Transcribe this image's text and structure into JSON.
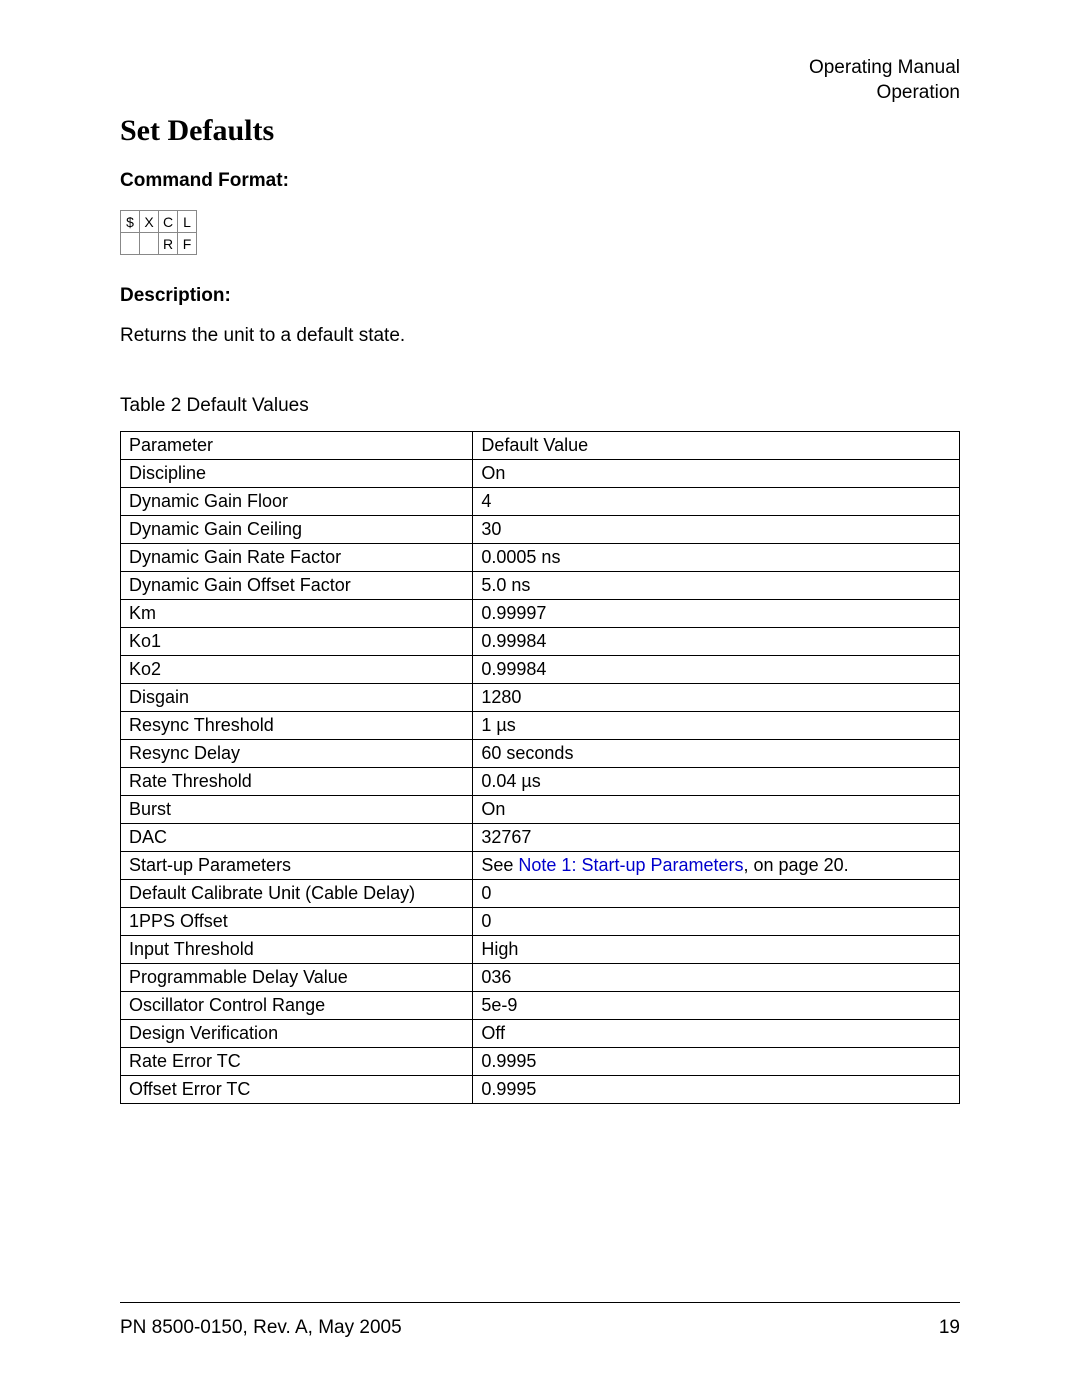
{
  "header": {
    "line1": "Operating Manual",
    "line2": "Operation"
  },
  "title": "Set Defaults",
  "labels": {
    "command_format": "Command Format:",
    "description": "Description:"
  },
  "command_grid": {
    "row1": [
      "$",
      "X",
      "C",
      "L"
    ],
    "row2": [
      "",
      "",
      "R",
      "F"
    ]
  },
  "description_text": "Returns the unit to a default state.",
  "table_caption": "Table 2  Default Values",
  "table": {
    "header": [
      "Parameter",
      "Default Value"
    ],
    "rows": [
      {
        "param": "Discipline",
        "value": "On"
      },
      {
        "param": "Dynamic Gain Floor",
        "value": "4"
      },
      {
        "param": "Dynamic Gain Ceiling",
        "value": "30"
      },
      {
        "param": "Dynamic Gain Rate Factor",
        "value": "0.0005 ns"
      },
      {
        "param": "Dynamic Gain Offset Factor",
        "value": "5.0 ns"
      },
      {
        "param": "Km",
        "value": "0.99997"
      },
      {
        "param": "Ko1",
        "value": "0.99984"
      },
      {
        "param": "Ko2",
        "value": "0.99984"
      },
      {
        "param": "Disgain",
        "value": "1280"
      },
      {
        "param": "Resync Threshold",
        "value": "1 µs"
      },
      {
        "param": "Resync Delay",
        "value": "60 seconds"
      },
      {
        "param": "Rate Threshold",
        "value": "0.04 µs"
      },
      {
        "param": "Burst",
        "value": "On"
      },
      {
        "param": "DAC",
        "value": "32767"
      },
      {
        "param": "Start-up Parameters",
        "value_prefix": "See ",
        "link": "Note 1: Start-up Parameters",
        "value_suffix": ", on page 20."
      },
      {
        "param": "Default Calibrate Unit (Cable Delay)",
        "value": "0"
      },
      {
        "param": "1PPS Offset",
        "value": "0"
      },
      {
        "param": "Input Threshold",
        "value": "High"
      },
      {
        "param": "Programmable Delay Value",
        "value": "036"
      },
      {
        "param": "Oscillator Control Range",
        "value": "5e-9"
      },
      {
        "param": "Design Verification",
        "value": "Off"
      },
      {
        "param": "Rate Error TC",
        "value": "0.9995"
      },
      {
        "param": "Offset Error TC",
        "value": "0.9995"
      }
    ]
  },
  "footer": {
    "left": "PN 8500-0150, Rev. A, May 2005",
    "right": "19"
  }
}
